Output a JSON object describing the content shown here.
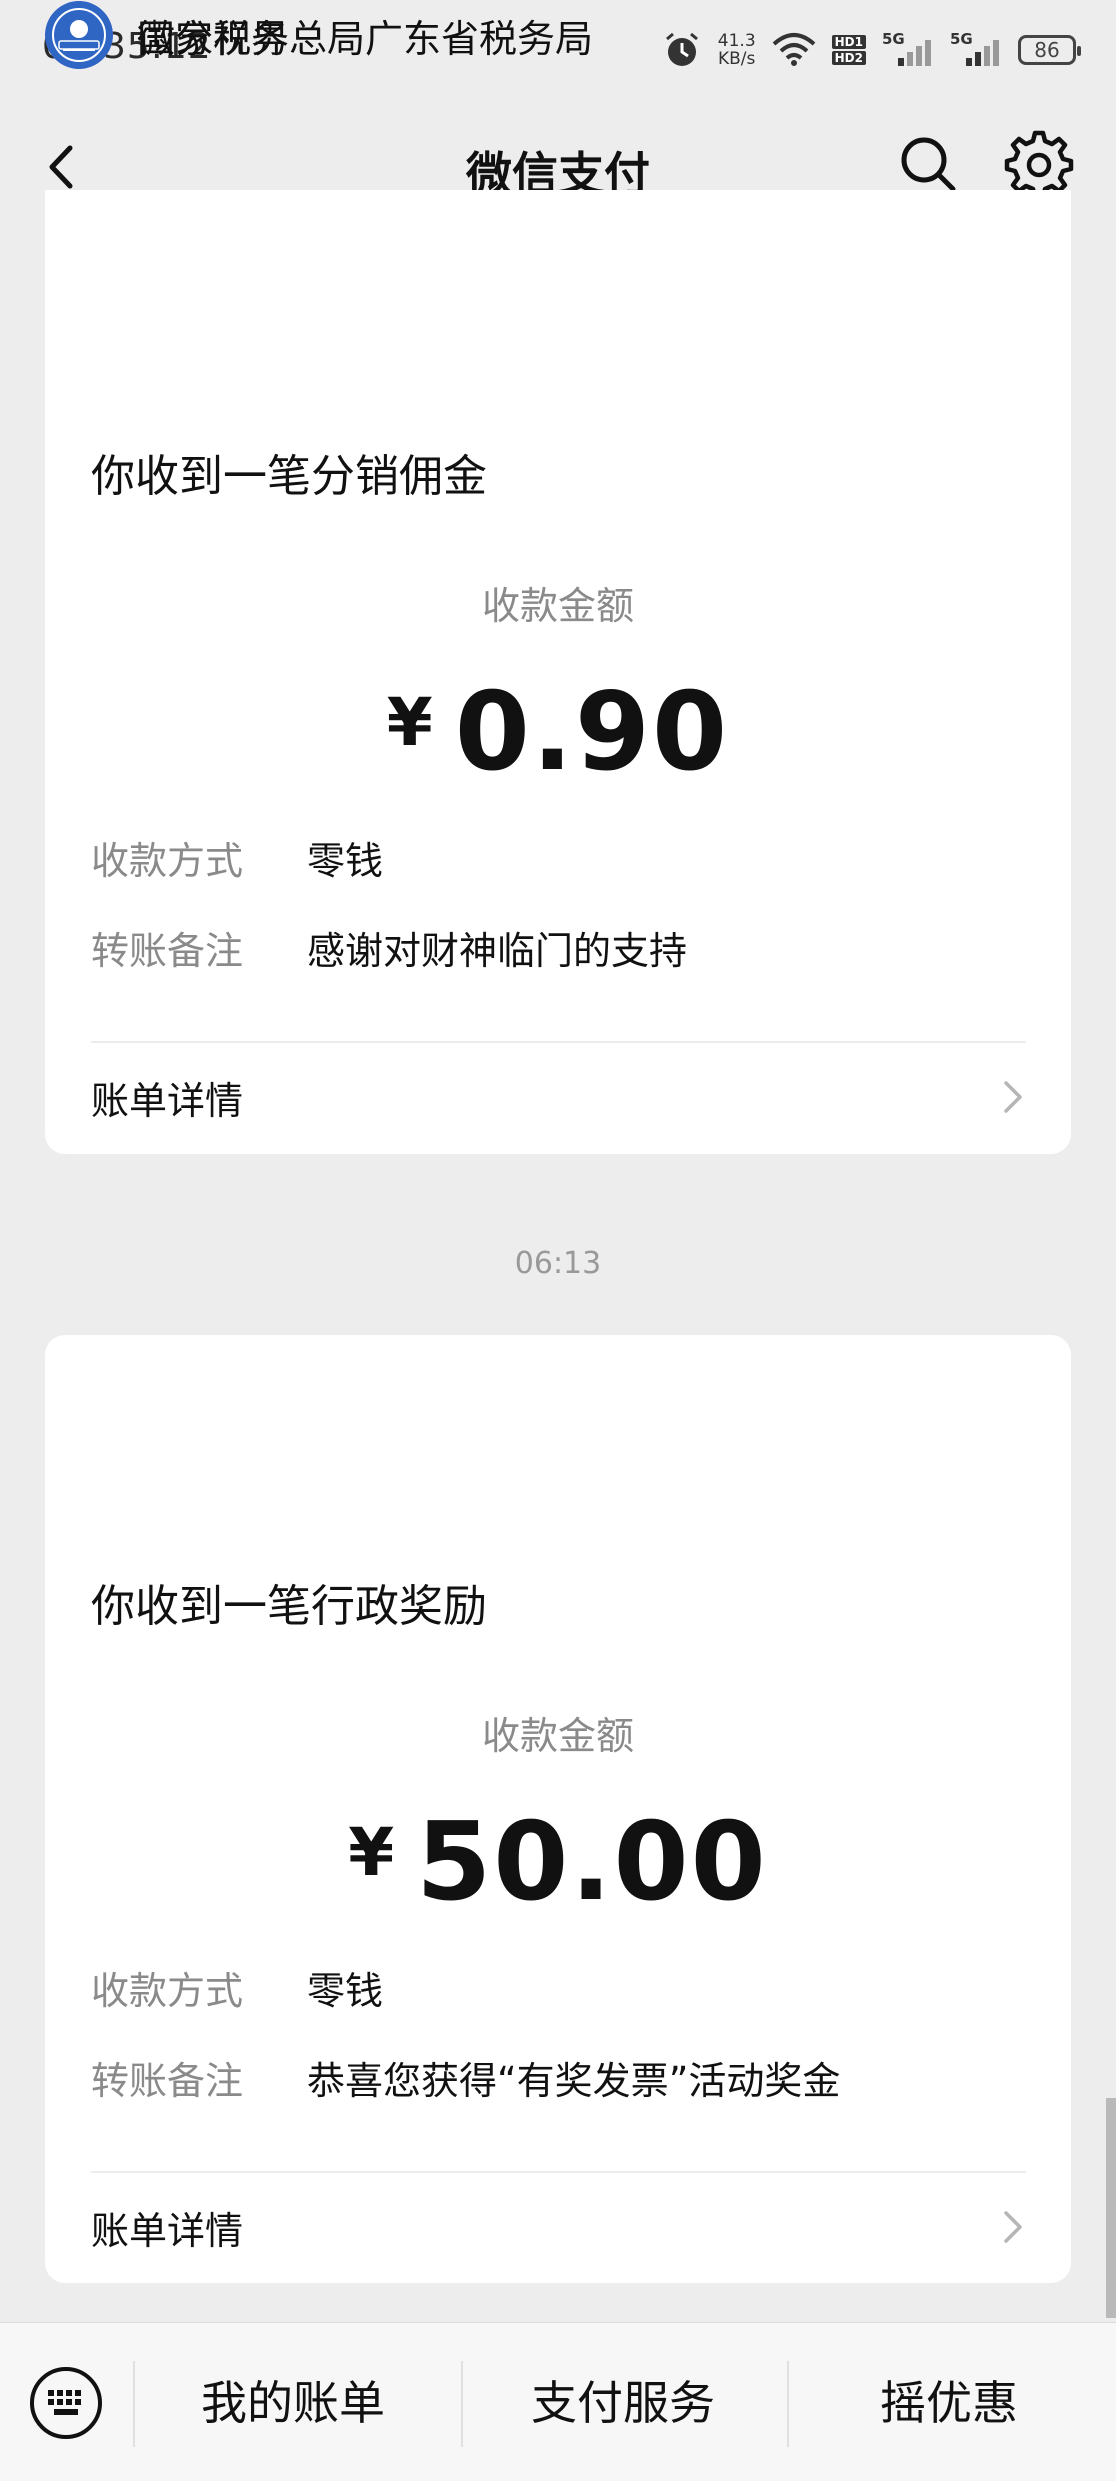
{
  "status_bar": {
    "time": "06:35:12",
    "net_speed_value": "41.3",
    "net_speed_unit": "KB/s",
    "hd1": "HD1",
    "hd2": "HD2",
    "sig1": "5G",
    "sig2": "5G",
    "battery": "86"
  },
  "nav": {
    "title": "微信支付"
  },
  "messages": [
    {
      "merchant": "微分视界",
      "title": "你收到一笔分销佣金",
      "amount_label": "收款金额",
      "currency": "¥",
      "amount": "0.90",
      "method_key": "收款方式",
      "method_value": "零钱",
      "note_key": "转账备注",
      "note_value": "感谢对财神临门的支持",
      "detail": "账单详情"
    },
    {
      "time": "06:13",
      "merchant": "国家税务总局广东省税务局",
      "title": "你收到一笔行政奖励",
      "amount_label": "收款金额",
      "currency": "¥",
      "amount": "50.00",
      "method_key": "收款方式",
      "method_value": "零钱",
      "note_key": "转账备注",
      "note_value": "恭喜您获得“有奖发票”活动奖金",
      "detail": "账单详情"
    }
  ],
  "bottom_bar": {
    "items": [
      "我的账单",
      "支付服务",
      "摇优惠"
    ]
  },
  "colors": {
    "background": "#ededed",
    "card": "#ffffff",
    "secondary_text": "#8a8a8a"
  }
}
